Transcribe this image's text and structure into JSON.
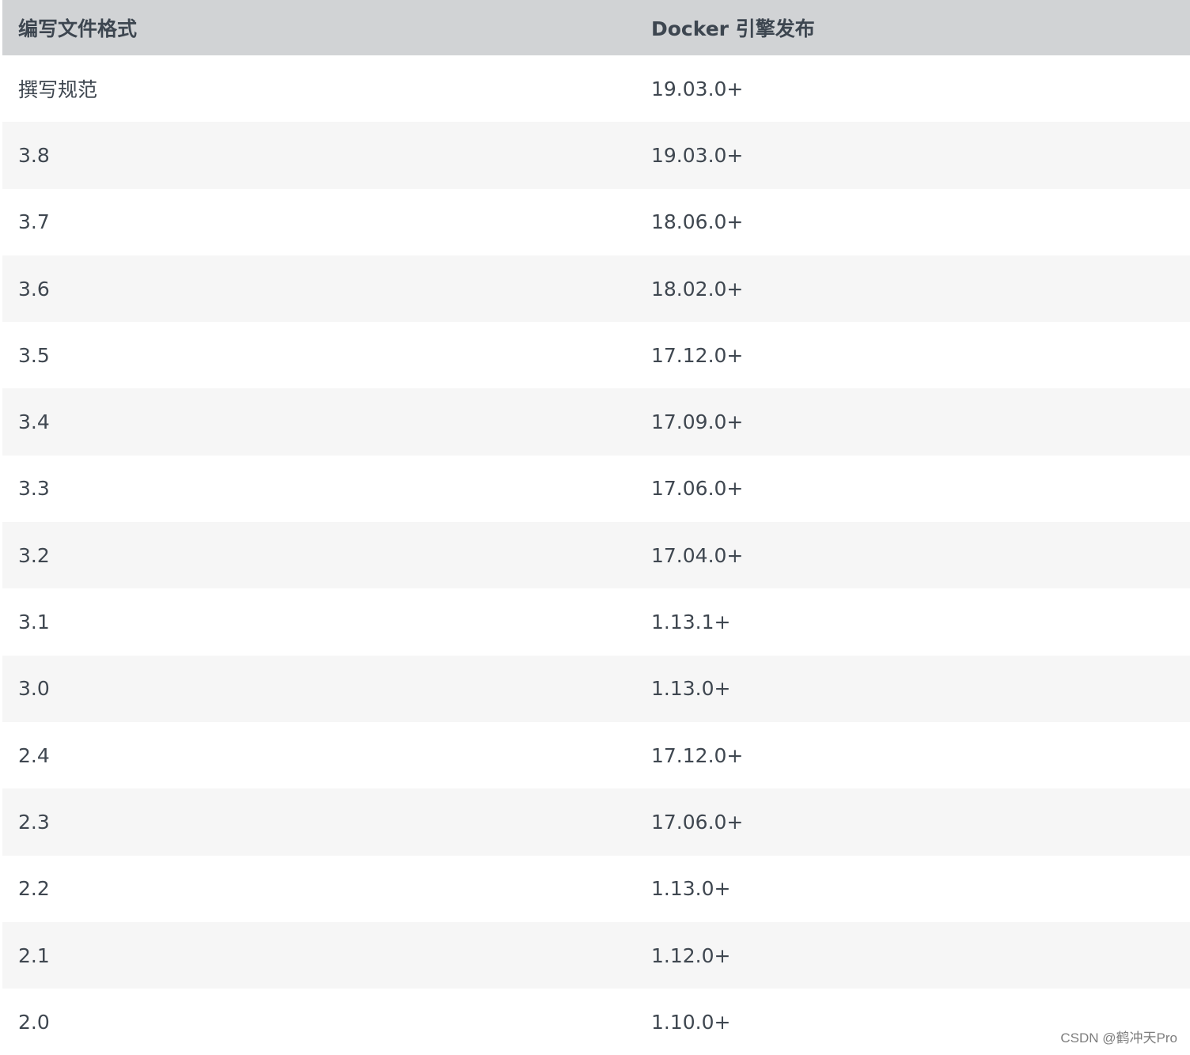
{
  "table": {
    "headers": [
      "编写文件格式",
      "Docker 引擎发布"
    ],
    "rows": [
      [
        "撰写规范",
        "19.03.0+"
      ],
      [
        "3.8",
        "19.03.0+"
      ],
      [
        "3.7",
        "18.06.0+"
      ],
      [
        "3.6",
        "18.02.0+"
      ],
      [
        "3.5",
        "17.12.0+"
      ],
      [
        "3.4",
        "17.09.0+"
      ],
      [
        "3.3",
        "17.06.0+"
      ],
      [
        "3.2",
        "17.04.0+"
      ],
      [
        "3.1",
        "1.13.1+"
      ],
      [
        "3.0",
        "1.13.0+"
      ],
      [
        "2.4",
        "17.12.0+"
      ],
      [
        "2.3",
        "17.06.0+"
      ],
      [
        "2.2",
        "1.13.0+"
      ],
      [
        "2.1",
        "1.12.0+"
      ],
      [
        "2.0",
        "1.10.0+"
      ]
    ]
  },
  "watermark": "CSDN @鹤冲天Pro"
}
